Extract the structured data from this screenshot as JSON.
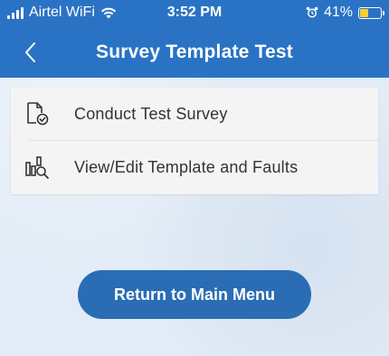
{
  "status_bar": {
    "carrier": "Airtel WiFi",
    "time": "3:52 PM",
    "battery_percent": "41%",
    "battery_level": 0.41,
    "icons": [
      "signal-icon",
      "wifi-icon",
      "alarm-icon",
      "battery-icon"
    ]
  },
  "header": {
    "title": "Survey Template Test",
    "back_icon": "chevron-left-icon"
  },
  "menu": {
    "items": [
      {
        "label": "Conduct Test Survey",
        "icon": "document-check-icon"
      },
      {
        "label": "View/Edit Template and Faults",
        "icon": "chart-search-icon"
      }
    ]
  },
  "footer": {
    "return_label": "Return to Main Menu"
  },
  "colors": {
    "header_blue": "#2a73c4",
    "button_blue": "#2a6db5",
    "background": "#e3ecf6",
    "battery_yellow": "#f2d22b"
  }
}
